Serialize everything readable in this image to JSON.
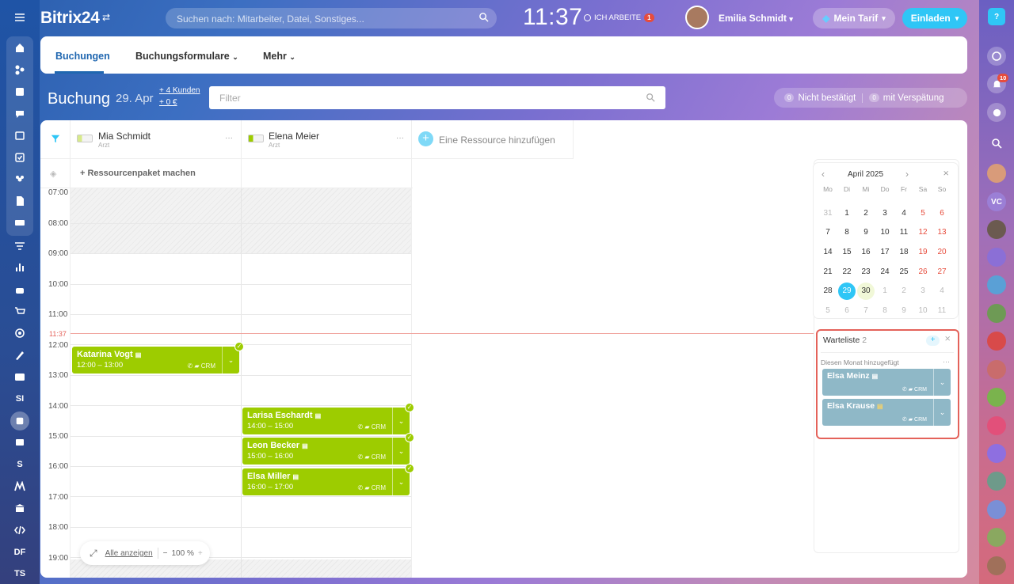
{
  "header": {
    "logo": "Bitrix24",
    "search_placeholder": "Suchen nach: Mitarbeiter, Datei, Sonstiges...",
    "clock": "11:37",
    "work_status": "ICH ARBEITE",
    "work_badge": "1",
    "user_name": "Emilia Schmidt",
    "tariff": "Mein Tarif",
    "invite": "Einladen",
    "help": "?"
  },
  "tabs": {
    "bookings": "Buchungen",
    "forms": "Buchungsformulare",
    "more": "Mehr"
  },
  "booking": {
    "title": "Buchung",
    "date": "29. Apr",
    "clients": "+ 4 Kunden",
    "revenue": "+ 0 €",
    "filter_placeholder": "Filter",
    "not_confirmed_count": "0",
    "not_confirmed": "Nicht bestätigt",
    "late_count": "0",
    "late": "mit Verspätung"
  },
  "resources": [
    {
      "name": "Mia Schmidt",
      "role": "Arzt"
    },
    {
      "name": "Elena Meier",
      "role": "Arzt"
    }
  ],
  "add_resource": "Eine Ressource hinzufügen",
  "package": "+ Ressourcenpaket machen",
  "times": [
    "07:00",
    "08:00",
    "09:00",
    "10:00",
    "11:00",
    "12:00",
    "13:00",
    "14:00",
    "15:00",
    "16:00",
    "17:00",
    "18:00",
    "19:00"
  ],
  "now": "11:37",
  "events": [
    {
      "name": "Katarina Vogt",
      "time": "12:00 – 13:00",
      "crm": "CRM"
    },
    {
      "name": "Larisa Eschardt",
      "time": "14:00 – 15:00",
      "crm": "CRM"
    },
    {
      "name": "Leon Becker",
      "time": "15:00 – 16:00",
      "crm": "CRM"
    },
    {
      "name": "Elsa Miller",
      "time": "16:00 – 17:00",
      "crm": "CRM"
    }
  ],
  "zoom": {
    "show_all": "Alle anzeigen",
    "level": "100 %",
    "minus": "−",
    "plus": "+"
  },
  "calendar": {
    "month": "April 2025",
    "weekdays": [
      "Mo",
      "Di",
      "Mi",
      "Do",
      "Fr",
      "Sa",
      "So"
    ],
    "weeks": [
      [
        "31",
        "1",
        "2",
        "3",
        "4",
        "5",
        "6"
      ],
      [
        "7",
        "8",
        "9",
        "10",
        "11",
        "12",
        "13"
      ],
      [
        "14",
        "15",
        "16",
        "17",
        "18",
        "19",
        "20"
      ],
      [
        "21",
        "22",
        "23",
        "24",
        "25",
        "26",
        "27"
      ],
      [
        "28",
        "29",
        "30",
        "1",
        "2",
        "3",
        "4"
      ],
      [
        "5",
        "6",
        "7",
        "8",
        "9",
        "10",
        "11"
      ]
    ],
    "selected": "29"
  },
  "waitlist": {
    "title": "Warteliste",
    "count": "2",
    "section": "Diesen Monat hinzugefügt",
    "items": [
      {
        "name": "Elsa Meinz",
        "crm": "CRM"
      },
      {
        "name": "Elsa Krause",
        "crm": "CRM"
      }
    ]
  },
  "left_bar": {
    "si": "SI",
    "s": "S",
    "df": "DF",
    "ts": "TS"
  },
  "right_bar": {
    "vc": "VC",
    "notif_badge": "10"
  }
}
